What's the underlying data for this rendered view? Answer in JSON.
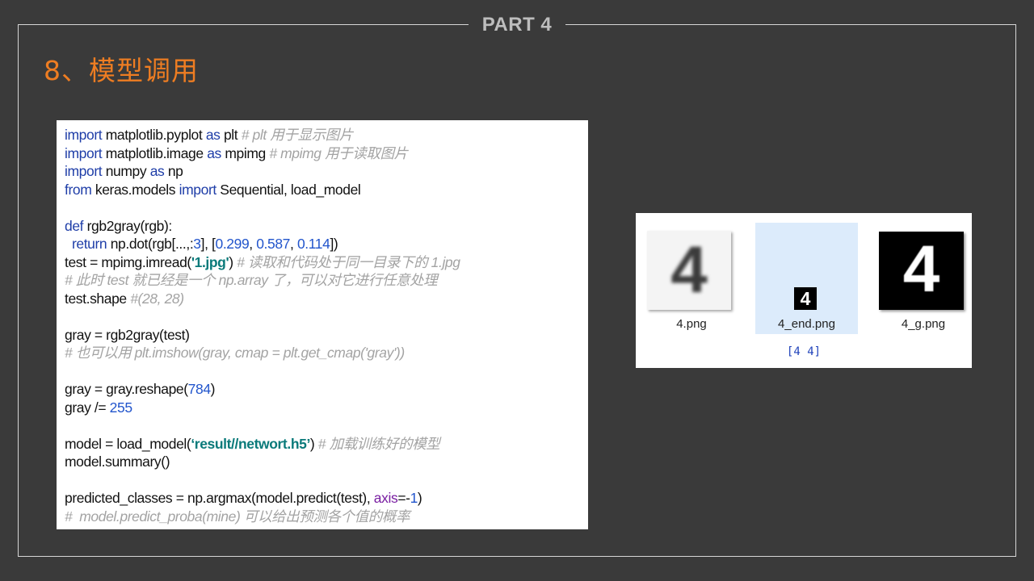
{
  "slide": {
    "part_label": "PART 4",
    "title": "8、模型调用"
  },
  "code": {
    "lines": [
      {
        "segs": [
          {
            "t": "import",
            "c": "kw"
          },
          {
            "t": " matplotlib.pyplot "
          },
          {
            "t": "as",
            "c": "kw"
          },
          {
            "t": " plt "
          },
          {
            "t": "# plt 用于显示图片",
            "c": "cm"
          }
        ]
      },
      {
        "segs": [
          {
            "t": "import",
            "c": "kw"
          },
          {
            "t": " matplotlib.image "
          },
          {
            "t": "as",
            "c": "kw"
          },
          {
            "t": " mpimg "
          },
          {
            "t": "# mpimg 用于读取图片",
            "c": "cm"
          }
        ]
      },
      {
        "segs": [
          {
            "t": "import",
            "c": "kw"
          },
          {
            "t": " numpy "
          },
          {
            "t": "as",
            "c": "kw"
          },
          {
            "t": " np"
          }
        ]
      },
      {
        "segs": [
          {
            "t": "from",
            "c": "kw"
          },
          {
            "t": " keras.models "
          },
          {
            "t": "import",
            "c": "kw"
          },
          {
            "t": " Sequential, load_model"
          }
        ]
      },
      {
        "segs": []
      },
      {
        "segs": [
          {
            "t": "def",
            "c": "kw"
          },
          {
            "t": " rgb2gray(rgb):"
          }
        ]
      },
      {
        "segs": [
          {
            "t": "  "
          },
          {
            "t": "return",
            "c": "kw"
          },
          {
            "t": " np.dot(rgb[...,:"
          },
          {
            "t": "3",
            "c": "num"
          },
          {
            "t": "], ["
          },
          {
            "t": "0.299",
            "c": "num"
          },
          {
            "t": ", "
          },
          {
            "t": "0.587",
            "c": "num"
          },
          {
            "t": ", "
          },
          {
            "t": "0.114",
            "c": "num"
          },
          {
            "t": "])"
          }
        ]
      },
      {
        "segs": [
          {
            "t": "test = mpimg.imread("
          },
          {
            "t": "'1.jpg'",
            "c": "str"
          },
          {
            "t": ") "
          },
          {
            "t": "# 读取和代码处于同一目录下的 1.jpg",
            "c": "cm"
          }
        ]
      },
      {
        "segs": [
          {
            "t": "# 此时 test 就已经是一个 np.array 了，可以对它进行任意处理",
            "c": "cm"
          }
        ]
      },
      {
        "segs": [
          {
            "t": "test.shape "
          },
          {
            "t": "#(28, 28)",
            "c": "cm"
          }
        ]
      },
      {
        "segs": []
      },
      {
        "segs": [
          {
            "t": "gray = rgb2gray(test)"
          }
        ]
      },
      {
        "segs": [
          {
            "t": "# 也可以用 plt.imshow(gray, cmap = plt.get_cmap('gray'))",
            "c": "cm"
          }
        ]
      },
      {
        "segs": []
      },
      {
        "segs": [
          {
            "t": "gray = gray.reshape("
          },
          {
            "t": "784",
            "c": "num"
          },
          {
            "t": ")"
          }
        ]
      },
      {
        "segs": [
          {
            "t": "gray /= "
          },
          {
            "t": "255",
            "c": "num"
          }
        ]
      },
      {
        "segs": []
      },
      {
        "segs": [
          {
            "t": "model = load_model("
          },
          {
            "t": "‘result//networt.h5’",
            "c": "str"
          },
          {
            "t": ") "
          },
          {
            "t": "# 加载训练好的模型",
            "c": "cm"
          }
        ]
      },
      {
        "segs": [
          {
            "t": "model.summary()"
          }
        ]
      },
      {
        "segs": []
      },
      {
        "segs": [
          {
            "t": "predicted_classes = np.argmax(model.predict(test), "
          },
          {
            "t": "axis",
            "c": "arg"
          },
          {
            "t": "=-"
          },
          {
            "t": "1",
            "c": "num"
          },
          {
            "t": ")"
          }
        ]
      },
      {
        "segs": [
          {
            "t": "#  model.predict_proba(mine) 可以给出预测各个值的概率",
            "c": "cm"
          }
        ]
      }
    ]
  },
  "files": {
    "items": [
      {
        "name": "4.png",
        "digit": "4"
      },
      {
        "name": "4_end.png",
        "digit": "4"
      },
      {
        "name": "4_g.png",
        "digit": "4"
      }
    ],
    "result": "[4 4]"
  }
}
